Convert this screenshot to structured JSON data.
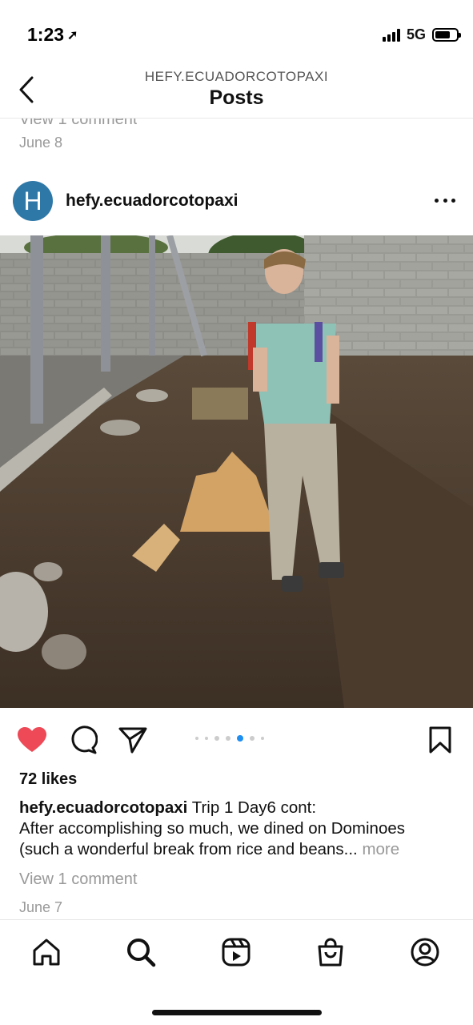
{
  "status_bar": {
    "time": "1:23",
    "network": "5G"
  },
  "header": {
    "subtitle": "HEFY.ECUADORCOTOPAXI",
    "title": "Posts"
  },
  "previous_post": {
    "comment_link": "View 1 comment",
    "date": "June 8"
  },
  "post": {
    "avatar_letter": "H",
    "avatar_color": "#2e78a8",
    "username": "hefy.ecuadorcotopaxi",
    "likes": "72 likes",
    "caption_user": "hefy.ecuadorcotopaxi",
    "caption_line1": "Trip 1 Day6 cont:",
    "caption_line2": "After accomplishing so much, we dined on Dominoes",
    "caption_line3": "(such a wonderful break from rice and beans...",
    "more": "more",
    "view_comments": "View 1 comment",
    "date": "June 7",
    "carousel": {
      "count": 7,
      "active_index": 4
    },
    "liked": true,
    "like_color": "#ed4956"
  },
  "icons": {
    "back": "chevron-left-icon",
    "more": "more-horizontal-icon",
    "like": "heart-icon",
    "comment": "comment-icon",
    "share": "send-icon",
    "save": "bookmark-icon",
    "home": "home-icon",
    "search": "search-icon",
    "reels": "reels-icon",
    "shop": "shop-icon",
    "profile": "profile-icon"
  }
}
